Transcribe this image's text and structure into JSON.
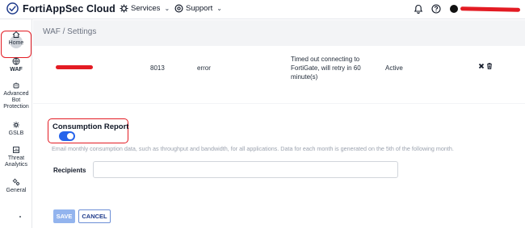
{
  "app": {
    "title": "FortiAppSec Cloud"
  },
  "topnav": {
    "services": "Services",
    "support": "Support"
  },
  "sidebar": {
    "items": [
      {
        "label": "Home",
        "icon": "home-icon"
      },
      {
        "label": "WAF",
        "icon": "waf-icon"
      },
      {
        "label": "Advanced Bot Protection",
        "icon": "bot-icon"
      },
      {
        "label": "GSLB",
        "icon": "gslb-icon"
      },
      {
        "label": "Threat Analytics",
        "icon": "analytics-icon"
      },
      {
        "label": "General",
        "icon": "gear-icon"
      }
    ],
    "line2": {
      "advanced": "Advanced",
      "bot": "Bot",
      "protection": "Protection",
      "threat": "Threat",
      "analytics": "Analytics"
    }
  },
  "breadcrumb": "WAF / Settings",
  "table": {
    "row": {
      "port": "8013",
      "status_code": "error",
      "message": "Timed out connecting to FortiGate, will retry in 60 minute(s)",
      "state": "Active"
    }
  },
  "consumption": {
    "title": "Consumption Report",
    "enabled": true,
    "description": "Email monthly consumption data, such as throughput and bandwidth, for all applications. Data for each month is generated on the 5th of the following month.",
    "recipients_label": "Recipients",
    "recipients_value": ""
  },
  "buttons": {
    "save": "SAVE",
    "cancel": "CANCEL"
  },
  "colors": {
    "accent": "#2563eb",
    "annotation": "#e31b23",
    "save_disabled": "#93b4ee"
  }
}
